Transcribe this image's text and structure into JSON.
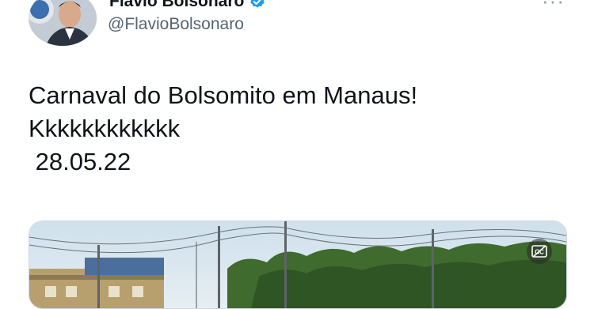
{
  "author": {
    "display_name": "Flavio Bolsonaro",
    "handle": "@FlavioBolsonaro",
    "verified": true,
    "avatar_icon": "profile-photo"
  },
  "menu": {
    "icon": "more-icon",
    "glyph": "···"
  },
  "tweet": {
    "text": "Carnaval do Bolsomito em Manaus!\nKkkkkkkkkkkk\n 28.05.22"
  },
  "media": {
    "type": "video",
    "captions_icon": "closed-captions-icon"
  },
  "colors": {
    "text": "#0f1419",
    "secondary": "#536471",
    "verified": "#1d9bf0"
  }
}
